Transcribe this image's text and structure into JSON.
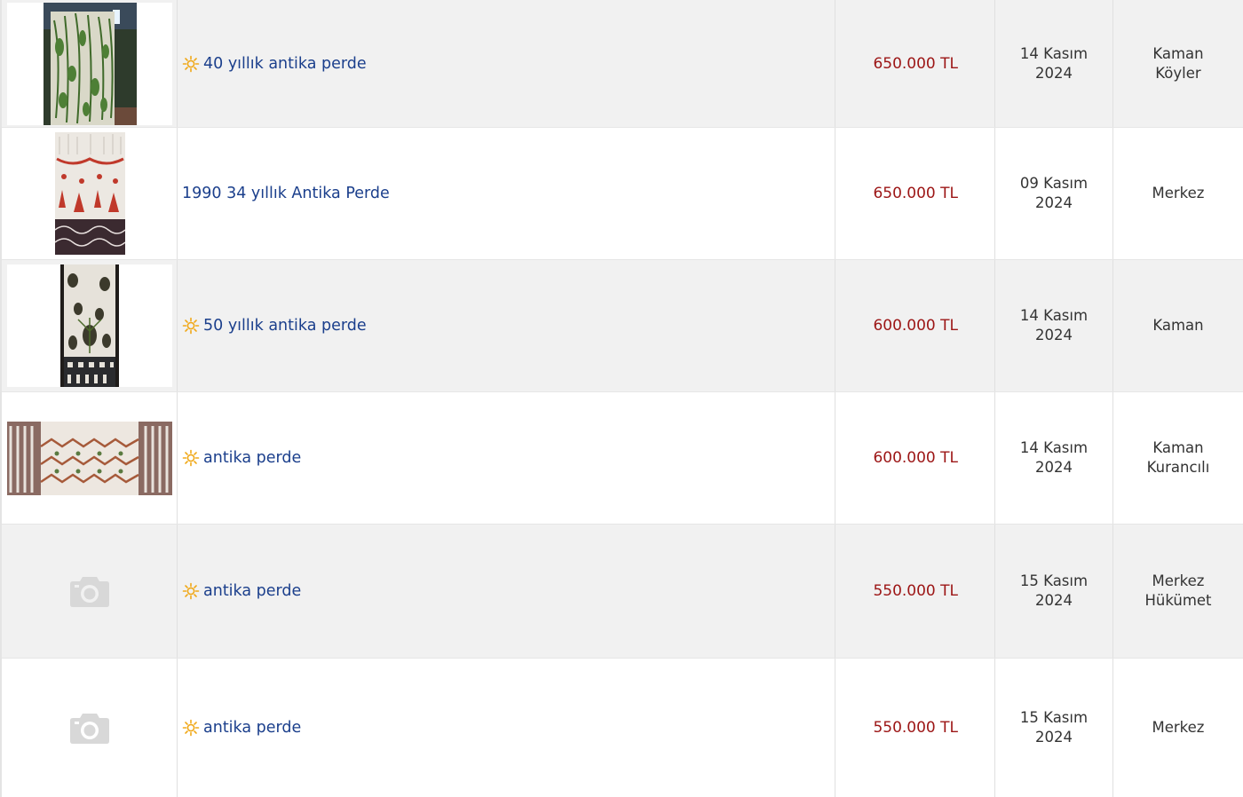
{
  "colors": {
    "title_link": "#1b3f8c",
    "price": "#9c1515",
    "row_alt_bg": "#f1f1f1",
    "row_bg": "#ffffff",
    "featured_icon": "#f0a818"
  },
  "listings": [
    {
      "thumbnail": "curtain-photo-green-floral",
      "featured_icon": "sun-icon",
      "title": "40 yıllık antika perde",
      "price": "650.000 TL",
      "date_day": "14 Kasım",
      "date_year": "2024",
      "location_line1": "Kaman",
      "location_line2": "Köyler"
    },
    {
      "thumbnail": "curtain-photo-red-pattern",
      "featured_icon": null,
      "title": "1990 34 yıllık Antika Perde",
      "price": "650.000 TL",
      "date_day": "09 Kasım",
      "date_year": "2024",
      "location_line1": "Merkez",
      "location_line2": ""
    },
    {
      "thumbnail": "curtain-photo-dark-floral",
      "featured_icon": "sun-icon",
      "title": "50 yıllık antika perde",
      "price": "600.000 TL",
      "date_day": "14 Kasım",
      "date_year": "2024",
      "location_line1": "Kaman",
      "location_line2": ""
    },
    {
      "thumbnail": "curtain-photo-brown-zigzag",
      "featured_icon": "sun-icon",
      "title": "antika perde",
      "price": "600.000 TL",
      "date_day": "14 Kasım",
      "date_year": "2024",
      "location_line1": "Kaman",
      "location_line2": "Kurancılı"
    },
    {
      "thumbnail": "camera-placeholder-icon",
      "featured_icon": "sun-icon",
      "title": "antika perde",
      "price": "550.000 TL",
      "date_day": "15 Kasım",
      "date_year": "2024",
      "location_line1": "Merkez",
      "location_line2": "Hükümet"
    },
    {
      "thumbnail": "camera-placeholder-icon",
      "featured_icon": "sun-icon",
      "title": "antika perde",
      "price": "550.000 TL",
      "date_day": "15 Kasım",
      "date_year": "2024",
      "location_line1": "Merkez",
      "location_line2": ""
    }
  ]
}
